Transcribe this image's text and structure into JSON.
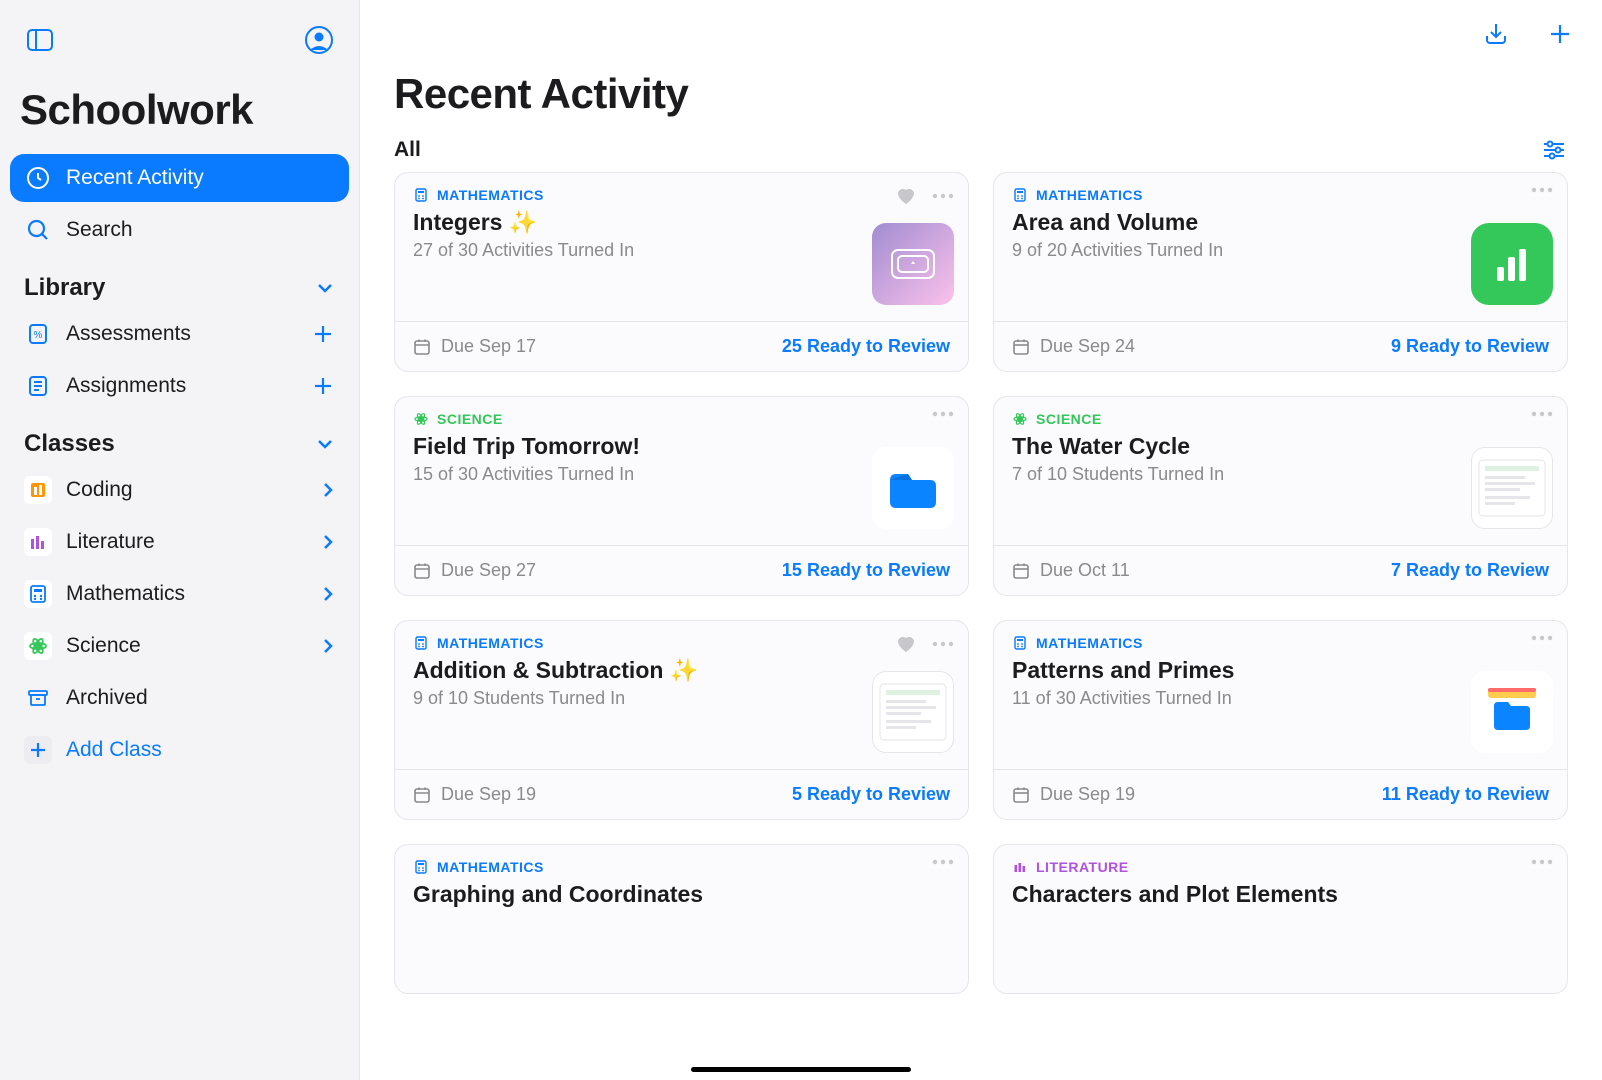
{
  "app_title": "Schoolwork",
  "page_title": "Recent Activity",
  "filter_label": "All",
  "sidebar": {
    "nav": [
      {
        "id": "recent",
        "label": "Recent Activity",
        "active": true
      },
      {
        "id": "search",
        "label": "Search",
        "active": false
      }
    ],
    "library_title": "Library",
    "library_items": [
      {
        "id": "assessments",
        "label": "Assessments"
      },
      {
        "id": "assignments",
        "label": "Assignments"
      }
    ],
    "classes_title": "Classes",
    "classes": [
      {
        "id": "coding",
        "label": "Coding",
        "color": "#ff9500"
      },
      {
        "id": "literature",
        "label": "Literature",
        "color": "#af52de"
      },
      {
        "id": "mathematics",
        "label": "Mathematics",
        "color": "#0a7aff"
      },
      {
        "id": "science",
        "label": "Science",
        "color": "#34c759"
      },
      {
        "id": "archived",
        "label": "Archived",
        "color": "#0a7aff",
        "archived": true
      }
    ],
    "add_class_label": "Add Class"
  },
  "cards": [
    {
      "subject": "MATHEMATICS",
      "subj_class": "math",
      "title": "Integers ✨",
      "subtitle": "27 of 30 Activities Turned In",
      "fav": true,
      "due": "Due Sep 17",
      "review": "25 Ready to Review",
      "thumb": "gradient"
    },
    {
      "subject": "MATHEMATICS",
      "subj_class": "math",
      "title": "Area and Volume",
      "subtitle": "9 of 20 Activities Turned In",
      "fav": false,
      "due": "Due Sep 24",
      "review": "9 Ready to Review",
      "thumb": "green"
    },
    {
      "subject": "SCIENCE",
      "subj_class": "sci",
      "title": "Field Trip Tomorrow!",
      "subtitle": "15 of 30 Activities Turned In",
      "fav": false,
      "due": "Due Sep 27",
      "review": "15 Ready to Review",
      "thumb": "blue"
    },
    {
      "subject": "SCIENCE",
      "subj_class": "sci",
      "title": "The Water Cycle",
      "subtitle": "7 of 10 Students Turned In",
      "fav": false,
      "due": "Due Oct 11",
      "review": "7 Ready to Review",
      "thumb": "doc"
    },
    {
      "subject": "MATHEMATICS",
      "subj_class": "math",
      "title": "Addition & Subtraction ✨",
      "subtitle": "9 of 10 Students Turned In",
      "fav": true,
      "due": "Due Sep 19",
      "review": "5 Ready to Review",
      "thumb": "doc"
    },
    {
      "subject": "MATHEMATICS",
      "subj_class": "math",
      "title": "Patterns and Primes",
      "subtitle": "11 of 30 Activities Turned In",
      "fav": false,
      "due": "Due Sep 19",
      "review": "11 Ready to Review",
      "thumb": "yellow"
    },
    {
      "subject": "MATHEMATICS",
      "subj_class": "math",
      "title": "Graphing and Coordinates",
      "subtitle": "",
      "fav": false,
      "due": "",
      "review": "",
      "thumb": "none"
    },
    {
      "subject": "LITERATURE",
      "subj_class": "lit",
      "title": "Characters and Plot Elements",
      "subtitle": "",
      "fav": false,
      "due": "",
      "review": "",
      "thumb": "none"
    }
  ]
}
